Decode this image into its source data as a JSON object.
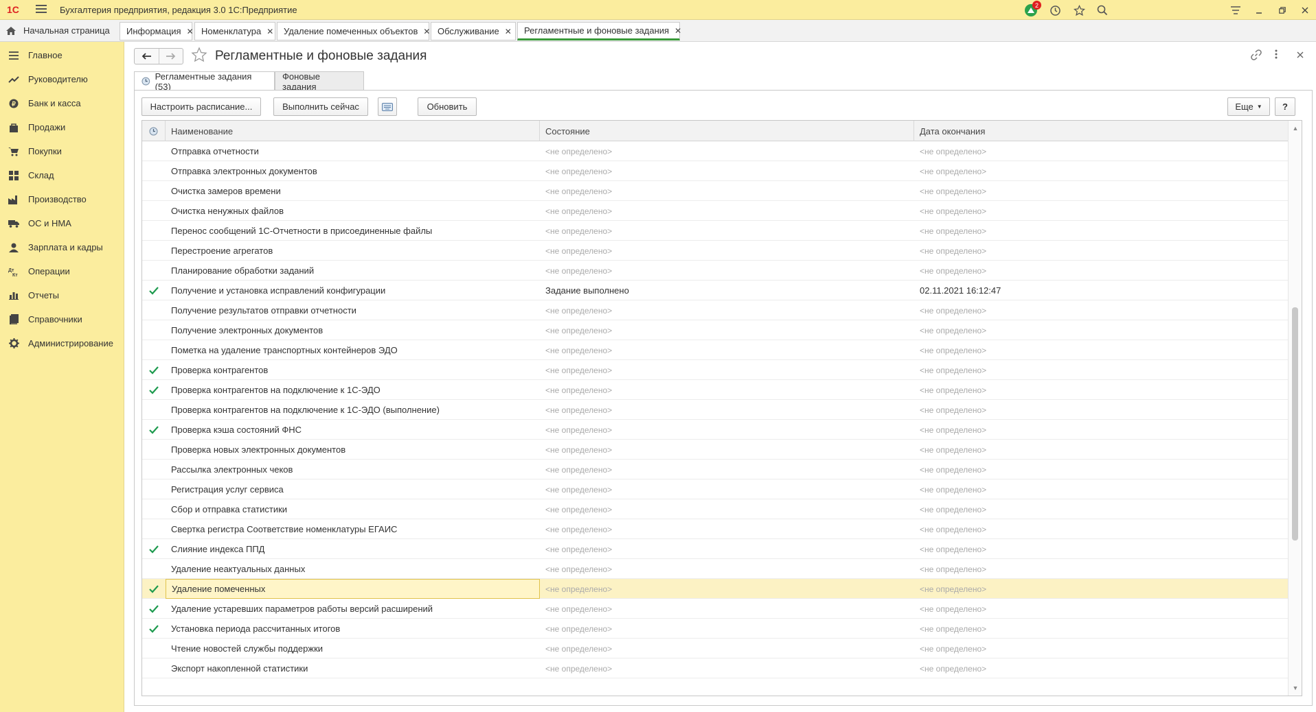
{
  "app": {
    "logo_text": "1С",
    "title": "Бухгалтерия предприятия, редакция 3.0 1С:Предприятие",
    "notifications_count": "2"
  },
  "tabs": {
    "home": "Начальная страница",
    "items": [
      {
        "label": "Информация"
      },
      {
        "label": "Номенклатура"
      },
      {
        "label": "Удаление помеченных объектов"
      },
      {
        "label": "Обслуживание"
      },
      {
        "label": "Регламентные и фоновые задания"
      }
    ],
    "close_glyph": "✕"
  },
  "sidebar": {
    "items": [
      {
        "label": "Главное",
        "icon": "menu-icon"
      },
      {
        "label": "Руководителю",
        "icon": "trend-icon"
      },
      {
        "label": "Банк и касса",
        "icon": "coin-icon"
      },
      {
        "label": "Продажи",
        "icon": "bag-icon"
      },
      {
        "label": "Покупки",
        "icon": "cart-icon"
      },
      {
        "label": "Склад",
        "icon": "grid-icon"
      },
      {
        "label": "Производство",
        "icon": "factory-icon"
      },
      {
        "label": "ОС и НМА",
        "icon": "truck-icon"
      },
      {
        "label": "Зарплата и кадры",
        "icon": "person-icon"
      },
      {
        "label": "Операции",
        "icon": "dtkt-icon"
      },
      {
        "label": "Отчеты",
        "icon": "bar-chart-icon"
      },
      {
        "label": "Справочники",
        "icon": "book-icon"
      },
      {
        "label": "Администрирование",
        "icon": "gear-icon"
      }
    ]
  },
  "page": {
    "title": "Регламентные и фоновые задания",
    "subtabs": {
      "scheduled": "Регламентные задания (53)",
      "background": "Фоновые задания"
    },
    "toolbar": {
      "schedule": "Настроить расписание...",
      "run_now": "Выполнить сейчас",
      "refresh": "Обновить",
      "more": "Еще",
      "help": "?"
    }
  },
  "table": {
    "columns": {
      "name": "Наименование",
      "state": "Состояние",
      "end_date": "Дата окончания"
    },
    "selected_index": 22,
    "rows": [
      {
        "check": false,
        "name": "Отправка отчетности",
        "state": "<не определено>",
        "date": "<не определено>"
      },
      {
        "check": false,
        "name": "Отправка электронных документов",
        "state": "<не определено>",
        "date": "<не определено>"
      },
      {
        "check": false,
        "name": "Очистка замеров времени",
        "state": "<не определено>",
        "date": "<не определено>"
      },
      {
        "check": false,
        "name": "Очистка ненужных файлов",
        "state": "<не определено>",
        "date": "<не определено>"
      },
      {
        "check": false,
        "name": "Перенос сообщений 1С-Отчетности в присоединенные файлы",
        "state": "<не определено>",
        "date": "<не определено>"
      },
      {
        "check": false,
        "name": "Перестроение агрегатов",
        "state": "<не определено>",
        "date": "<не определено>"
      },
      {
        "check": false,
        "name": "Планирование обработки заданий",
        "state": "<не определено>",
        "date": "<не определено>"
      },
      {
        "check": true,
        "name": "Получение и установка исправлений конфигурации",
        "state": "Задание выполнено",
        "date": "02.11.2021 16:12:47"
      },
      {
        "check": false,
        "name": "Получение результатов отправки отчетности",
        "state": "<не определено>",
        "date": "<не определено>"
      },
      {
        "check": false,
        "name": "Получение электронных документов",
        "state": "<не определено>",
        "date": "<не определено>"
      },
      {
        "check": false,
        "name": "Пометка на удаление транспортных контейнеров ЭДО",
        "state": "<не определено>",
        "date": "<не определено>"
      },
      {
        "check": true,
        "name": "Проверка контрагентов",
        "state": "<не определено>",
        "date": "<не определено>"
      },
      {
        "check": true,
        "name": "Проверка контрагентов на подключение к 1С-ЭДО",
        "state": "<не определено>",
        "date": "<не определено>"
      },
      {
        "check": false,
        "name": "Проверка контрагентов на подключение к 1С-ЭДО (выполнение)",
        "state": "<не определено>",
        "date": "<не определено>"
      },
      {
        "check": true,
        "name": "Проверка кэша состояний ФНС",
        "state": "<не определено>",
        "date": "<не определено>"
      },
      {
        "check": false,
        "name": "Проверка новых электронных документов",
        "state": "<не определено>",
        "date": "<не определено>"
      },
      {
        "check": false,
        "name": "Рассылка электронных чеков",
        "state": "<не определено>",
        "date": "<не определено>"
      },
      {
        "check": false,
        "name": "Регистрация услуг сервиса",
        "state": "<не определено>",
        "date": "<не определено>"
      },
      {
        "check": false,
        "name": "Сбор и отправка статистики",
        "state": "<не определено>",
        "date": "<не определено>"
      },
      {
        "check": false,
        "name": "Свертка регистра Соответствие номенклатуры ЕГАИС",
        "state": "<не определено>",
        "date": "<не определено>"
      },
      {
        "check": true,
        "name": "Слияние индекса ППД",
        "state": "<не определено>",
        "date": "<не определено>"
      },
      {
        "check": false,
        "name": "Удаление неактуальных данных",
        "state": "<не определено>",
        "date": "<не определено>"
      },
      {
        "check": true,
        "name": "Удаление помеченных",
        "state": "<не определено>",
        "date": "<не определено>"
      },
      {
        "check": true,
        "name": "Удаление устаревших параметров работы версий расширений",
        "state": "<не определено>",
        "date": "<не определено>"
      },
      {
        "check": true,
        "name": "Установка периода рассчитанных итогов",
        "state": "<не определено>",
        "date": "<не определено>"
      },
      {
        "check": false,
        "name": "Чтение новостей службы поддержки",
        "state": "<не определено>",
        "date": "<не определено>"
      },
      {
        "check": false,
        "name": "Экспорт накопленной статистики",
        "state": "<не определено>",
        "date": "<не определено>"
      }
    ],
    "scroll_position": 0.55
  },
  "colors": {
    "accent_yellow": "#fbed9e",
    "check_green": "#1d9a4e",
    "active_tab_underline": "#3a9a3a",
    "notification_red": "#e02020"
  }
}
